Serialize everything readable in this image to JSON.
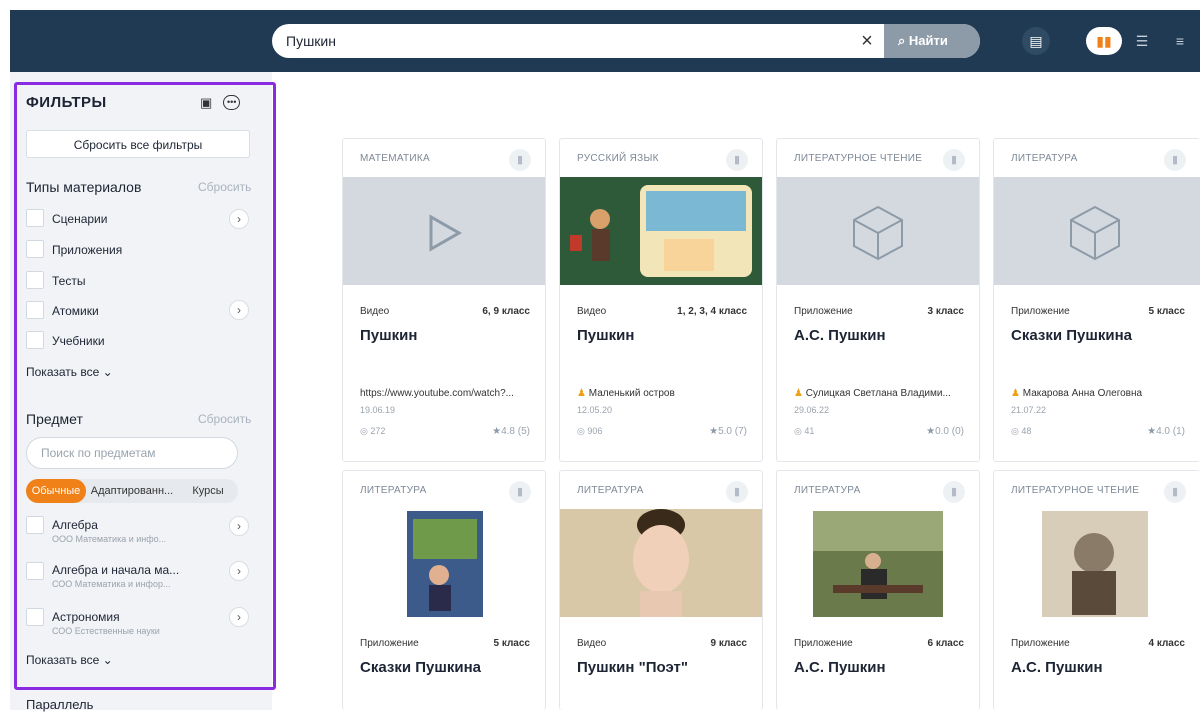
{
  "search": {
    "value": "Пушкин",
    "clear_icon": "×",
    "button_label": "Найти"
  },
  "header": {
    "calendar_icon": "▤",
    "view_grid_icon": "▮▮",
    "view_list_icon": "☰",
    "view_compact_icon": "≡"
  },
  "filters": {
    "title": "ФИЛЬТРЫ",
    "save_icon": "▣",
    "more_icon": "•••",
    "reset_all": "Сбросить все фильтры",
    "types": {
      "title": "Типы материалов",
      "reset": "Сбросить",
      "items": [
        {
          "label": "Сценарии"
        },
        {
          "label": "Приложения"
        },
        {
          "label": "Тесты"
        },
        {
          "label": "Атомики"
        },
        {
          "label": "Учебники"
        }
      ],
      "show_all": "Показать все ⌄"
    },
    "subject": {
      "title": "Предмет",
      "reset": "Сбросить",
      "search_placeholder": "Поиск по предметам",
      "tabs": [
        "Обычные",
        "Адаптированн...",
        "Курсы"
      ],
      "items": [
        {
          "label": "Алгебра",
          "sub": "ООО Математика и инфо..."
        },
        {
          "label": "Алгебра и начала ма...",
          "sub": "СОО Математика и инфор..."
        },
        {
          "label": "Астрономия",
          "sub": "СОО Естественные науки"
        }
      ],
      "show_all": "Показать все ⌄"
    },
    "parallel": {
      "title": "Параллель"
    }
  },
  "cards": [
    {
      "subject": "МАТЕМАТИКА",
      "kind": "Видео",
      "grade": "6, 9 класс",
      "title": "Пушкин",
      "author": "https://www.youtube.com/watch?...",
      "date": "19.06.19",
      "views": "272",
      "rating": "4.8 (5)"
    },
    {
      "subject": "РУССКИЙ ЯЗЫК",
      "kind": "Видео",
      "grade": "1, 2, 3, 4 класс",
      "title": "Пушкин",
      "author": "Маленький остров",
      "date": "12.05.20",
      "views": "906",
      "rating": "5.0 (7)"
    },
    {
      "subject": "ЛИТЕРАТУРНОЕ ЧТЕНИЕ",
      "kind": "Приложение",
      "grade": "3 класс",
      "title": "А.С. Пушкин",
      "author": "Сулицкая Светлана Владими...",
      "date": "29.06.22",
      "views": "41",
      "rating": "0.0 (0)"
    },
    {
      "subject": "ЛИТЕРАТУРА",
      "kind": "Приложение",
      "grade": "5 класс",
      "title": "Сказки Пушкина",
      "author": "Макарова Анна Олеговна",
      "date": "21.07.22",
      "views": "48",
      "rating": "4.0 (1)"
    },
    {
      "subject": "ЛИТЕРАТУРА",
      "kind": "Приложение",
      "grade": "5 класс",
      "title": "Сказки Пушкина"
    },
    {
      "subject": "ЛИТЕРАТУРА",
      "kind": "Видео",
      "grade": "9 класс",
      "title": "Пушкин \"Поэт\""
    },
    {
      "subject": "ЛИТЕРАТУРА",
      "kind": "Приложение",
      "grade": "6 класс",
      "title": "А.С. Пушкин"
    },
    {
      "subject": "ЛИТЕРАТУРНОЕ ЧТЕНИЕ",
      "kind": "Приложение",
      "grade": "4 класс",
      "title": "А.С. Пушкин"
    }
  ],
  "colors": {
    "header": "#1f3a52",
    "accent": "#f08018",
    "highlight": "#8a2be2"
  }
}
